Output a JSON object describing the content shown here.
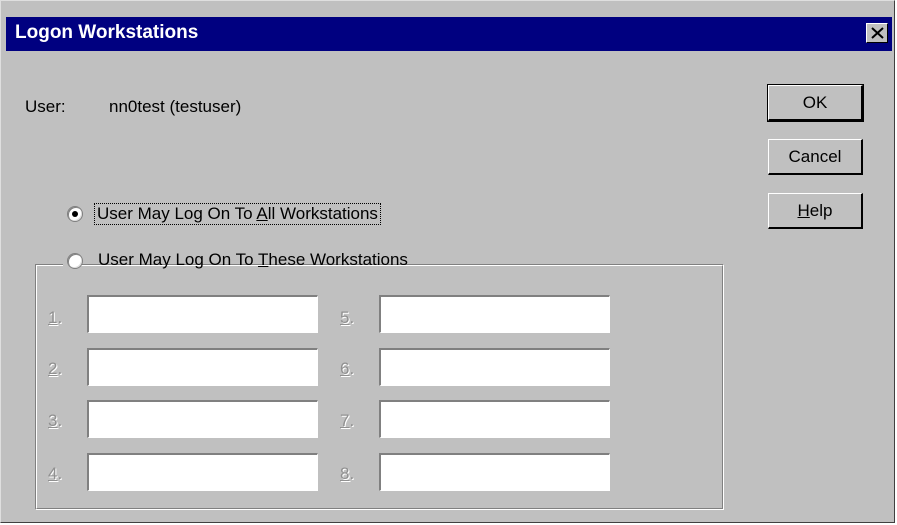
{
  "window": {
    "title": "Logon Workstations"
  },
  "user": {
    "label": "User:",
    "value": "nn0test (testuser)"
  },
  "buttons": {
    "ok": "OK",
    "cancel": "Cancel",
    "help_h": "H",
    "help_rest": "elp"
  },
  "options": {
    "all": {
      "pre": "User May Log On To ",
      "accel": "A",
      "post": "ll Workstations",
      "selected": true
    },
    "these": {
      "pre": "User May Log On To ",
      "accel": "T",
      "post": "hese Workstations",
      "selected": false
    }
  },
  "workstations": {
    "labels": [
      "1",
      "2",
      "3",
      "4",
      "5",
      "6",
      "7",
      "8"
    ],
    "values": [
      "",
      "",
      "",
      "",
      "",
      "",
      "",
      ""
    ]
  },
  "colors": {
    "titlebar": "#000080",
    "dialog": "#c0c0c0",
    "disabled_text": "#909090"
  }
}
